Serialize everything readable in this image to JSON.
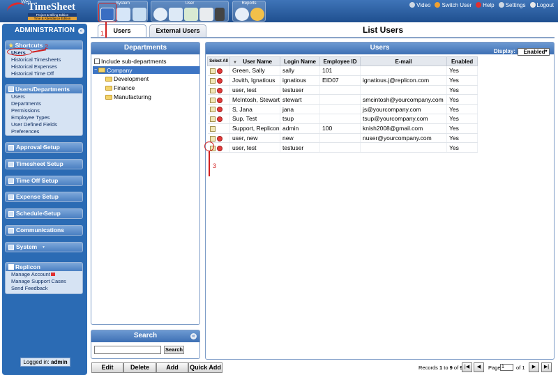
{
  "app": {
    "logo_web": "Web",
    "logo_name": "TimeSheet",
    "logo_edition1": "Project & Billing Edition",
    "logo_edition2": "Time & Attendance Edition"
  },
  "menu_groups": [
    {
      "label": "System",
      "icons": [
        "users-icon",
        "book-icon",
        "pen-icon"
      ]
    },
    {
      "label": "User",
      "icons": [
        "clock-icon",
        "timeoff-icon",
        "expense-icon",
        "calculator-icon",
        "traffic-light-icon"
      ]
    },
    {
      "label": "Reports",
      "icons": [
        "magnifier-icon",
        "gears-icon"
      ]
    }
  ],
  "top_links": [
    "Video",
    "Switch User",
    "Help",
    "Settings",
    "Logout"
  ],
  "sidebar": {
    "title": "ADMINISTRATION",
    "shortcuts": {
      "header": "Shortcuts",
      "items": [
        "Users",
        "Historical Timesheets",
        "Historical Expenses",
        "Historical Time Off"
      ]
    },
    "users_departments": {
      "header": "Users/Departments",
      "items": [
        "Users",
        "Departments",
        "Permissions",
        "Employee Types",
        "User Defined Fields",
        "Preferences"
      ]
    },
    "sections": [
      "Approval Setup",
      "Timesheet Setup",
      "Time Off Setup",
      "Expense Setup",
      "Schedule Setup",
      "Communications",
      "System"
    ],
    "replicon": {
      "header": "Replicon",
      "items": [
        "Manage Account",
        "Manage Support Cases",
        "Send Feedback"
      ]
    },
    "logged_in_label": "Logged in:",
    "logged_in_user": "admin"
  },
  "tabs": [
    "Users",
    "External Users"
  ],
  "page_title": "List Users",
  "departments": {
    "header": "Departments",
    "include_sub": "Include sub-departments",
    "root": "Company",
    "children": [
      "Development",
      "Finance",
      "Manufacturing"
    ]
  },
  "search": {
    "header": "Search",
    "button": "Search",
    "value": ""
  },
  "users": {
    "header": "Users",
    "display_label": "Display:",
    "display_value": "Enabled",
    "columns": [
      "Select All",
      "User Name",
      "Login Name",
      "Employee ID",
      "E-mail",
      "Enabled"
    ],
    "rows": [
      {
        "name": "Green, Sally",
        "login": "sally",
        "emp": "101",
        "email": "",
        "enabled": "Yes",
        "del": true
      },
      {
        "name": "Jovith, Ignatious",
        "login": "ignatious",
        "emp": "EID07",
        "email": "ignatious.j@replicon.com",
        "enabled": "Yes",
        "del": true
      },
      {
        "name": "user, test",
        "login": "testuser",
        "emp": "",
        "email": "",
        "enabled": "Yes",
        "del": true
      },
      {
        "name": "McIntosh, Stewart",
        "login": "stewart",
        "emp": "",
        "email": "smcintosh@yourcompany.com",
        "enabled": "Yes",
        "del": true
      },
      {
        "name": "S, Jana",
        "login": "jana",
        "emp": "",
        "email": "js@yourcompany.com",
        "enabled": "Yes",
        "del": true
      },
      {
        "name": "Sup, Test",
        "login": "tsup",
        "emp": "",
        "email": "tsup@yourcompany.com",
        "enabled": "Yes",
        "del": true
      },
      {
        "name": "Support, Replicon",
        "login": "admin",
        "emp": "100",
        "email": "knish2008@gmail.com",
        "enabled": "Yes",
        "del": false
      },
      {
        "name": "user, new",
        "login": "new",
        "emp": "",
        "email": "nuser@yourcompany.com",
        "enabled": "Yes",
        "del": true
      },
      {
        "name": "user, test",
        "login": "testuser",
        "emp": "",
        "email": "",
        "enabled": "Yes",
        "del": true
      }
    ]
  },
  "bottom_buttons": [
    "Edit",
    "Delete",
    "Add",
    "Quick Add"
  ],
  "pagination": {
    "records_prefix": "Records",
    "from": "1",
    "to_word": "to",
    "to": "9",
    "of_word": "of",
    "total": "9",
    "page_label": "Page",
    "page": "1",
    "of_pages": "of 1"
  },
  "annotations": [
    "1",
    "2",
    "3"
  ],
  "colors": {
    "annotation": "#d21f1f",
    "header_blue": "#3d6fb4",
    "sidebar": "#2b6bb4"
  }
}
